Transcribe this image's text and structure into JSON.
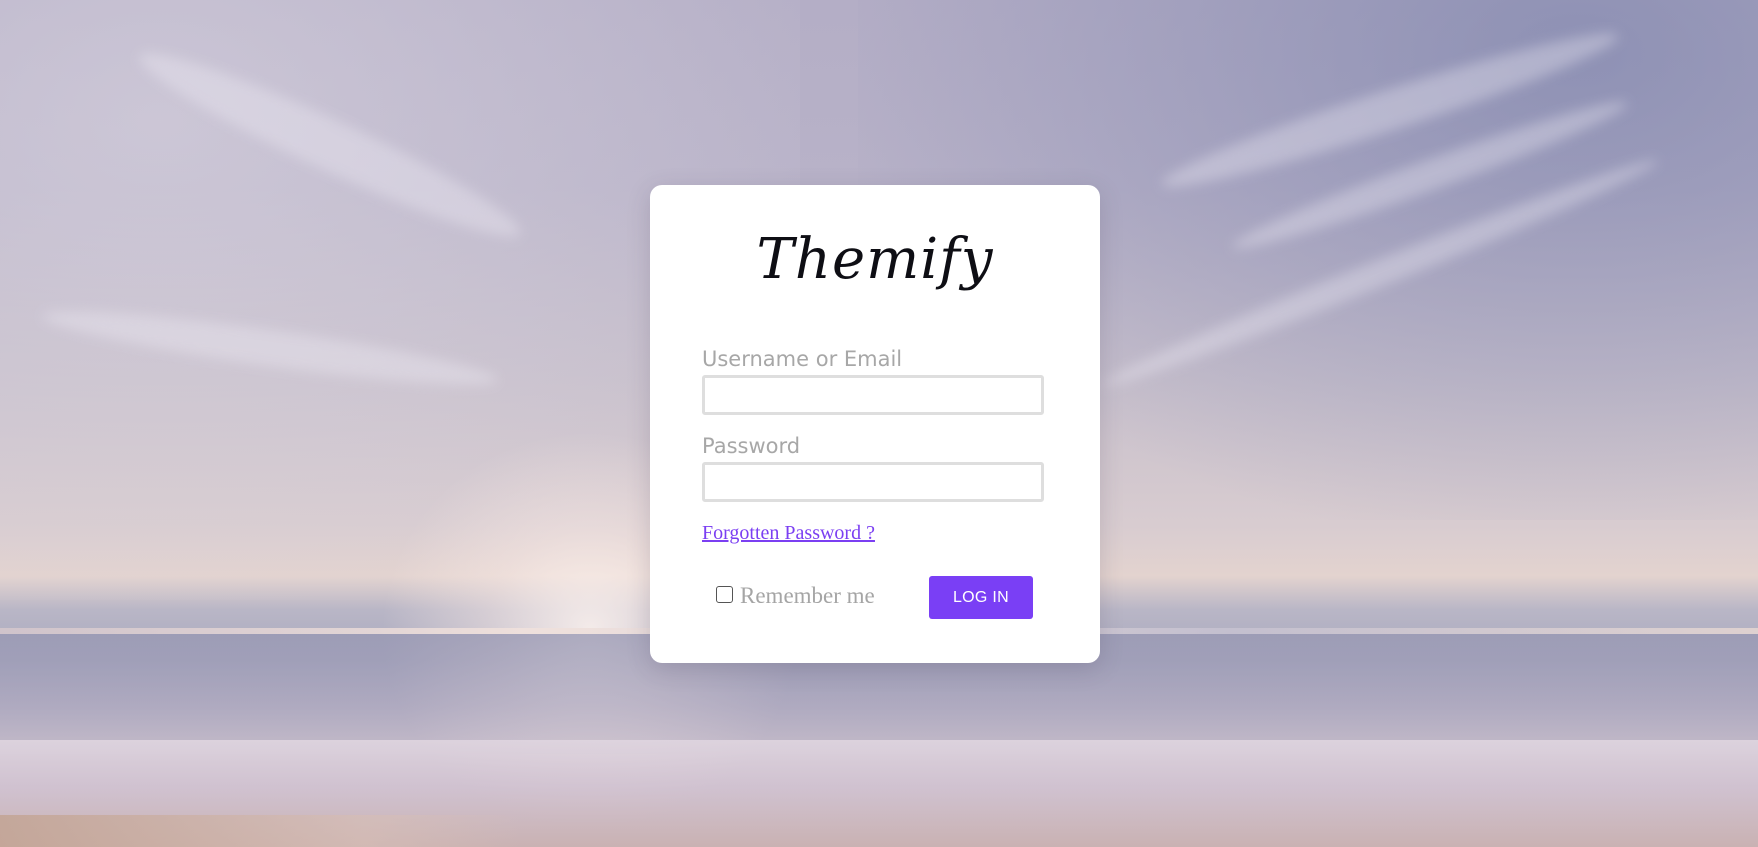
{
  "brand": {
    "logo_text": "Themify"
  },
  "login_form": {
    "username_label": "Username or Email",
    "username_value": "",
    "password_label": "Password",
    "password_value": "",
    "forgot_link": "Forgotten Password ?",
    "remember_label": "Remember me",
    "remember_checked": false,
    "login_button": "LOG IN"
  },
  "colors": {
    "accent": "#7a3ff5",
    "link": "#7b3ff2",
    "label": "#a7a7a7",
    "card_background": "#ffffff"
  }
}
